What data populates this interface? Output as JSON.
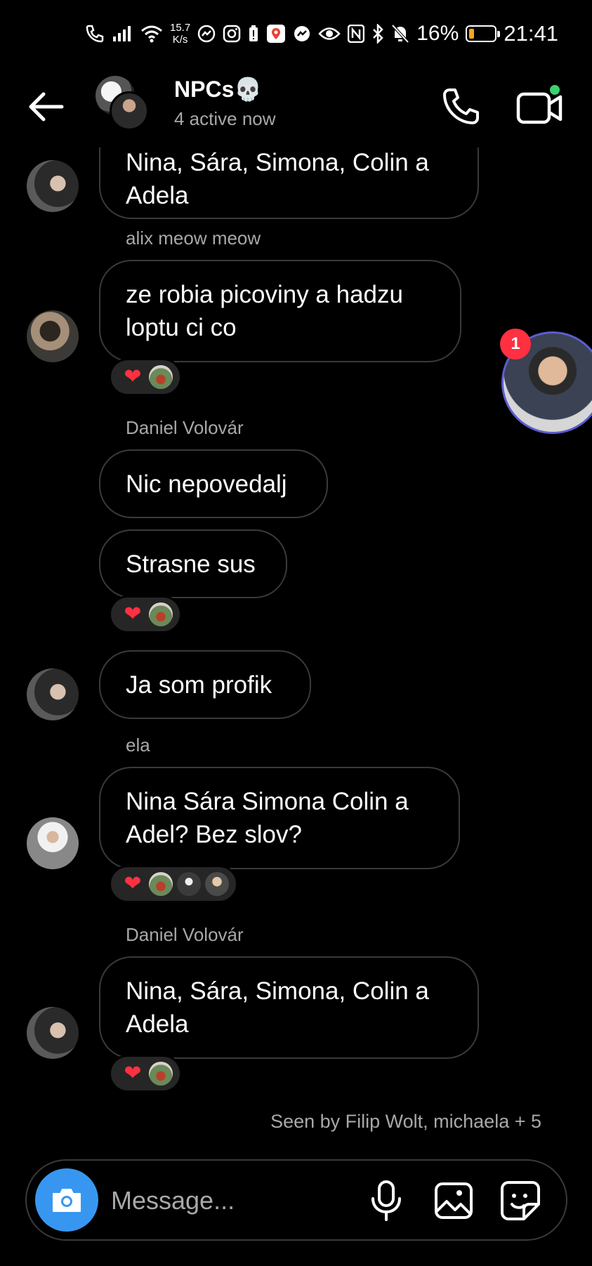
{
  "status_bar": {
    "net_speed_value": "15.7",
    "net_speed_unit": "K/s",
    "battery_pct": "16%",
    "time": "21:41",
    "battery_color": "#f5a623"
  },
  "header": {
    "title": "NPCs💀",
    "subtitle": "4 active now",
    "active_dot_color": "#3cd070"
  },
  "messages": [
    {
      "sender": "",
      "text": "Nina, Sára, Simona, Colin a\nAdela",
      "avatar": "daniel",
      "reactions": []
    },
    {
      "sender": "alix meow meow",
      "text": "ze robia picoviny a hadzu\nloptu ci co",
      "avatar": "alix",
      "reactions": [
        "heart",
        "avatar-1"
      ]
    },
    {
      "sender": "Daniel Volovár",
      "text": "Nic nepovedalj",
      "avatar": "",
      "reactions": []
    },
    {
      "sender": "",
      "text": "Strasne sus",
      "avatar": "",
      "reactions": [
        "heart",
        "avatar-1"
      ]
    },
    {
      "sender": "",
      "text": "Ja som profik",
      "avatar": "daniel",
      "reactions": []
    },
    {
      "sender": "ela",
      "text": "Nina Sára Simona Colin a\nAdel? Bez slov?",
      "avatar": "ela",
      "reactions": [
        "heart",
        "avatar-1",
        "avatar-2",
        "avatar-3"
      ]
    },
    {
      "sender": "Daniel Volovár",
      "text": "Nina, Sára, Simona, Colin a\nAdela",
      "avatar": "daniel",
      "reactions": [
        "heart",
        "avatar-1"
      ]
    }
  ],
  "seen_by": "Seen by Filip Wolt, michaela + 5",
  "chat_head": {
    "badge_count": "1"
  },
  "composer": {
    "placeholder": "Message...",
    "accent_color": "#3797f0"
  },
  "icons": {
    "back": "arrow-left-icon",
    "call": "phone-icon",
    "video": "video-camera-icon",
    "camera": "camera-icon",
    "mic": "microphone-icon",
    "gallery": "image-icon",
    "sticker": "sticker-icon",
    "reaction": "heart-icon"
  }
}
